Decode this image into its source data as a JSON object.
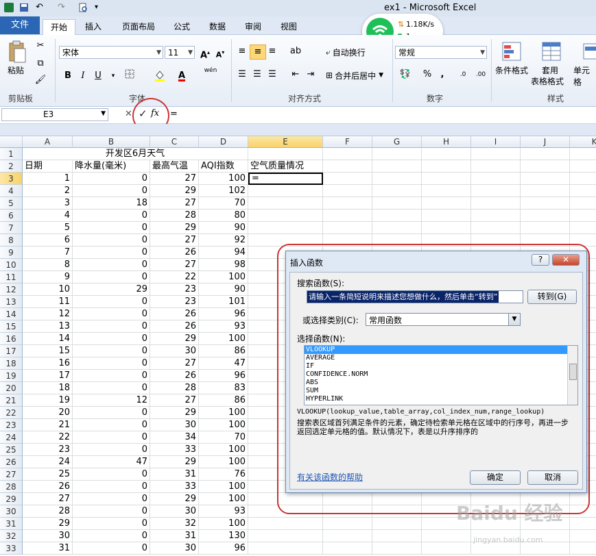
{
  "window": {
    "title": "ex1 - Microsoft Excel"
  },
  "tabs": [
    {
      "label": "文件"
    },
    {
      "label": "开始"
    },
    {
      "label": "插入"
    },
    {
      "label": "页面布局"
    },
    {
      "label": "公式"
    },
    {
      "label": "数据"
    },
    {
      "label": "审阅"
    },
    {
      "label": "视图"
    }
  ],
  "network": {
    "speed": "1.18K/s",
    "count": "1"
  },
  "ribbon": {
    "clipboard": {
      "paste": "粘贴",
      "group": "剪贴板"
    },
    "font": {
      "name": "宋体",
      "size": "11",
      "group": "字体",
      "bold": "B",
      "italic": "I",
      "underline": "U",
      "phonetic": "wén"
    },
    "alignment": {
      "wrap": "自动换行",
      "merge": "合并后居中",
      "group": "对齐方式"
    },
    "number": {
      "format": "常规",
      "percent": "%",
      "comma": ",",
      "group": "数字"
    },
    "styles": {
      "conditional": "条件格式",
      "table_fmt_1": "套用",
      "table_fmt_2": "表格格式",
      "cell_styles": "单元格",
      "group": "样式"
    }
  },
  "formula_bar": {
    "name_box": "E3",
    "cancel": "✕",
    "enter": "✓",
    "fx": "fx",
    "content": "="
  },
  "columns": [
    "A",
    "B",
    "C",
    "D",
    "E",
    "F",
    "G",
    "H",
    "I",
    "J",
    "K"
  ],
  "sheet": {
    "title": "开发区6月天气",
    "headers": [
      "日期",
      "降水量(毫米)",
      "最高气温",
      "AQI指数",
      "空气质量情况"
    ],
    "active_cell": "=",
    "row_numbers": [
      "3",
      "4",
      "5",
      "6",
      "7",
      "8",
      "9",
      "10",
      "11",
      "12",
      "13",
      "14",
      "15",
      "16",
      "17",
      "18",
      "19",
      "20",
      "21",
      "22",
      "23",
      "24",
      "25",
      "26",
      "27",
      "28",
      "29",
      "30",
      "31",
      "32",
      "33"
    ],
    "rows": [
      [
        "1",
        "0",
        "27",
        "100"
      ],
      [
        "2",
        "0",
        "29",
        "102"
      ],
      [
        "3",
        "18",
        "27",
        "70"
      ],
      [
        "4",
        "0",
        "28",
        "80"
      ],
      [
        "5",
        "0",
        "29",
        "90"
      ],
      [
        "6",
        "0",
        "27",
        "92"
      ],
      [
        "7",
        "0",
        "26",
        "94"
      ],
      [
        "8",
        "0",
        "27",
        "98"
      ],
      [
        "9",
        "0",
        "22",
        "100"
      ],
      [
        "10",
        "29",
        "23",
        "90"
      ],
      [
        "11",
        "0",
        "23",
        "101"
      ],
      [
        "12",
        "0",
        "26",
        "96"
      ],
      [
        "13",
        "0",
        "26",
        "93"
      ],
      [
        "14",
        "0",
        "29",
        "100"
      ],
      [
        "15",
        "0",
        "30",
        "86"
      ],
      [
        "16",
        "0",
        "27",
        "47"
      ],
      [
        "17",
        "0",
        "26",
        "96"
      ],
      [
        "18",
        "0",
        "28",
        "83"
      ],
      [
        "19",
        "12",
        "27",
        "86"
      ],
      [
        "20",
        "0",
        "29",
        "100"
      ],
      [
        "21",
        "0",
        "30",
        "100"
      ],
      [
        "22",
        "0",
        "34",
        "70"
      ],
      [
        "23",
        "0",
        "33",
        "100"
      ],
      [
        "24",
        "47",
        "29",
        "100"
      ],
      [
        "25",
        "0",
        "31",
        "76"
      ],
      [
        "26",
        "0",
        "33",
        "100"
      ],
      [
        "27",
        "0",
        "29",
        "100"
      ],
      [
        "28",
        "0",
        "30",
        "93"
      ],
      [
        "29",
        "0",
        "32",
        "100"
      ],
      [
        "30",
        "0",
        "31",
        "130"
      ],
      [
        "31",
        "0",
        "30",
        "96"
      ]
    ]
  },
  "dialog": {
    "title": "插入函数",
    "help_btn": "?",
    "close_btn": "✕",
    "search_label": "搜索函数(S):",
    "search_value": "请输入一条简短说明来描述您想做什么，然后单击“转到”",
    "go_btn": "转到(G)",
    "category_label": "或选择类别(C):",
    "category_value": "常用函数",
    "select_label": "选择函数(N):",
    "functions": [
      "VLOOKUP",
      "AVERAGE",
      "IF",
      "CONFIDENCE.NORM",
      "ABS",
      "SUM",
      "HYPERLINK"
    ],
    "signature": "VLOOKUP(lookup_value,table_array,col_index_num,range_lookup)",
    "description": "搜索表区域首列满足条件的元素，确定待检索单元格在区域中的行序号，再进一步返回选定单元格的值。默认情况下，表是以升序排序的",
    "help_link": "有关该函数的帮助",
    "ok_btn": "确定",
    "cancel_btn": "取消"
  },
  "watermark": {
    "main": "Baidu 经验",
    "sub": "jingyan.baidu.com"
  }
}
